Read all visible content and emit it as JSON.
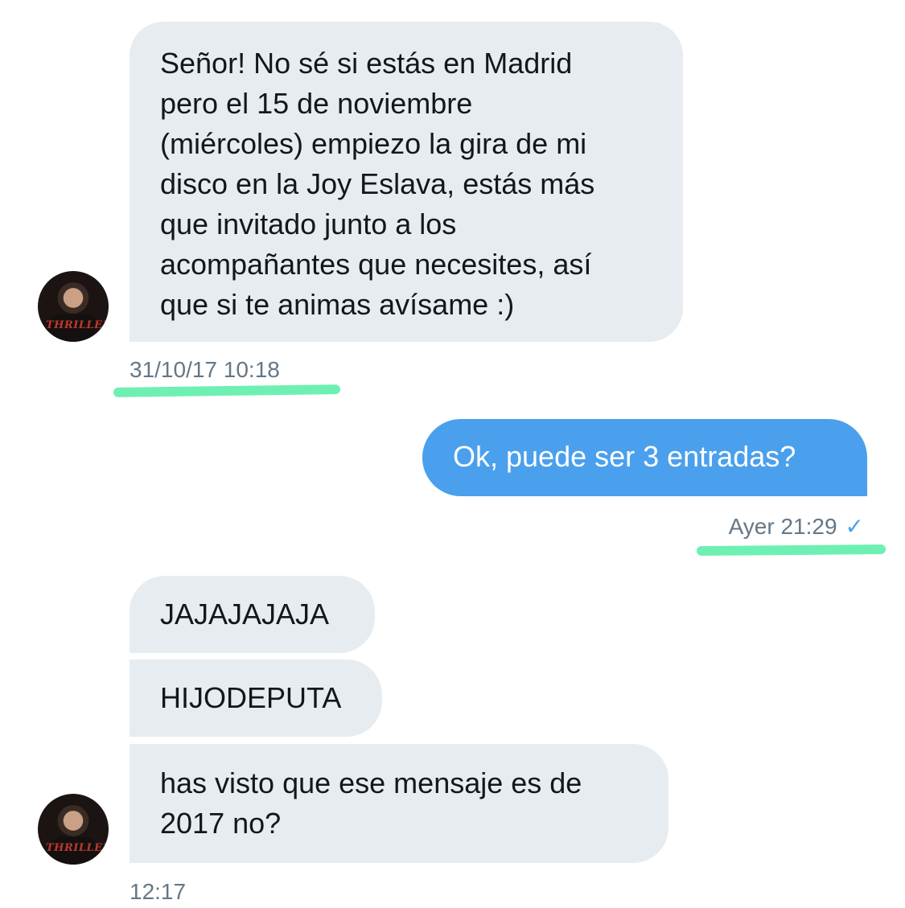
{
  "conversation": {
    "messages": [
      {
        "sender": "contact",
        "text": "Señor! No sé si estás en Madrid\npero el 15 de noviembre\n(miércoles) empiezo la gira de mi\ndisco en la Joy Eslava, estás más\nque invitado junto a los\nacompañantes que necesites, así\nque si te animas avísame :)"
      },
      {
        "sender": "me",
        "text": "Ok, puede ser 3 entradas?"
      },
      {
        "sender": "contact",
        "text": "JAJAJAJAJA"
      },
      {
        "sender": "contact",
        "text": "HIJODEPUTA"
      },
      {
        "sender": "contact",
        "text": "has visto que ese mensaje es de\n2017 no?"
      }
    ],
    "timestamps": {
      "first": "31/10/17 10:18",
      "reply": "Ayer 21:29",
      "last": "12:17"
    },
    "read_receipt_icon": "✓",
    "avatar_shirt_text": "THRILLER"
  },
  "colors": {
    "incoming_bubble": "#e6ecf0",
    "outgoing_bubble": "#4aa0ec",
    "timestamp": "#657786",
    "highlight": "#6ef0b4"
  }
}
